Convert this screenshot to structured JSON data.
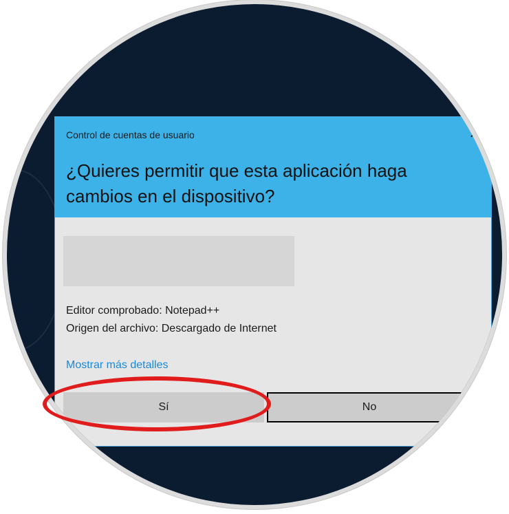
{
  "dialog": {
    "window_title": "Control de cuentas de usuario",
    "question": "¿Quieres permitir que esta aplicación haga cambios en el dispositivo?",
    "publisher_line": "Editor comprobado: Notepad++",
    "origin_line": "Origen del archivo: Descargado de Internet",
    "details_link": "Mostrar más detalles",
    "yes_button": "Sí",
    "no_button": "No",
    "close_icon": "close-icon",
    "header_color": "#3db2e8",
    "highlight_color": "#e11c1c"
  }
}
